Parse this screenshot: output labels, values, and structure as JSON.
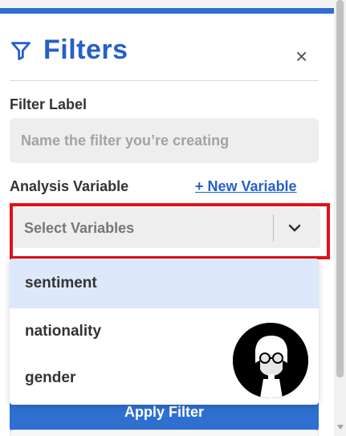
{
  "panel": {
    "title": "Filters",
    "close_label": "×",
    "filter_label": {
      "label": "Filter Label",
      "placeholder": "Name the filter you’re creating",
      "value": ""
    },
    "analysis_variable": {
      "label": "Analysis Variable",
      "new_variable_link": "+ New Variable",
      "select_placeholder": "Select Variables",
      "options": [
        "sentiment",
        "nationality",
        "gender"
      ],
      "highlighted_option": "sentiment"
    },
    "apply_button": "Apply Filter"
  },
  "icons": {
    "filter": "filter-icon",
    "close": "close-icon",
    "chevron": "chevron-down-icon",
    "avatar": "avatar"
  },
  "colors": {
    "accent": "#2660c9",
    "top_bar": "#2f6fd0",
    "highlight_outline": "#e0101b",
    "option_highlight": "#dde8fa"
  }
}
